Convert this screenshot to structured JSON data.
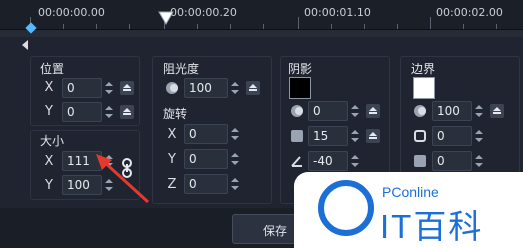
{
  "timeline": {
    "tick_labels": [
      "00:00:00.00",
      "00:00:00.20",
      "00:00:01.10",
      "00:00:02.00"
    ]
  },
  "position": {
    "title": "位置",
    "x_label": "X",
    "x_value": "0",
    "y_label": "Y",
    "y_value": "0"
  },
  "size": {
    "title": "大小",
    "x_label": "X",
    "x_value": "111",
    "y_label": "Y",
    "y_value": "100"
  },
  "opacity": {
    "title": "阻光度",
    "value": "100"
  },
  "rotation": {
    "title": "旋转",
    "x_label": "X",
    "x_value": "0",
    "y_label": "Y",
    "y_value": "0",
    "z_label": "Z",
    "z_value": "0"
  },
  "shadow": {
    "title": "阴影",
    "swatch_color": "#000000",
    "opacity_value": "0",
    "blur_value": "15",
    "angle_value": "-40"
  },
  "border": {
    "title": "边界",
    "swatch_color": "#ffffff",
    "opacity_value": "100",
    "width_value": "0",
    "blur_value": "0"
  },
  "footer": {
    "save_label": "保存"
  },
  "watermark": {
    "small": "PConline",
    "big": "IT百科"
  },
  "colors": {
    "accent": "#1d6fd8",
    "annotation": "#e23a2d",
    "keyframe": "#55b9ff"
  }
}
